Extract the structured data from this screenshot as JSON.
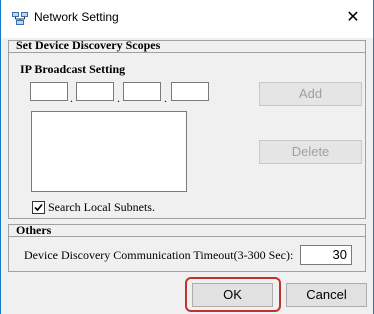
{
  "window": {
    "title": "Network Setting"
  },
  "discovery": {
    "group_title": "Set Device Discovery Scopes",
    "ip_broadcast": {
      "title": "IP Broadcast Setting",
      "ip_octets": [
        "",
        "",
        "",
        ""
      ],
      "separator": ".",
      "add_label": "Add",
      "delete_label": "Delete",
      "list_items": []
    },
    "search_local_subnets": {
      "label": "Search Local Subnets.",
      "checked": true
    }
  },
  "others": {
    "title": "Others",
    "timeout_label": "Device Discovery Communication Timeout(3-300 Sec):",
    "timeout_value": "30"
  },
  "footer": {
    "ok_label": "OK",
    "cancel_label": "Cancel"
  },
  "colors": {
    "highlight": "#c0322c",
    "window_border": "#1979ca"
  }
}
